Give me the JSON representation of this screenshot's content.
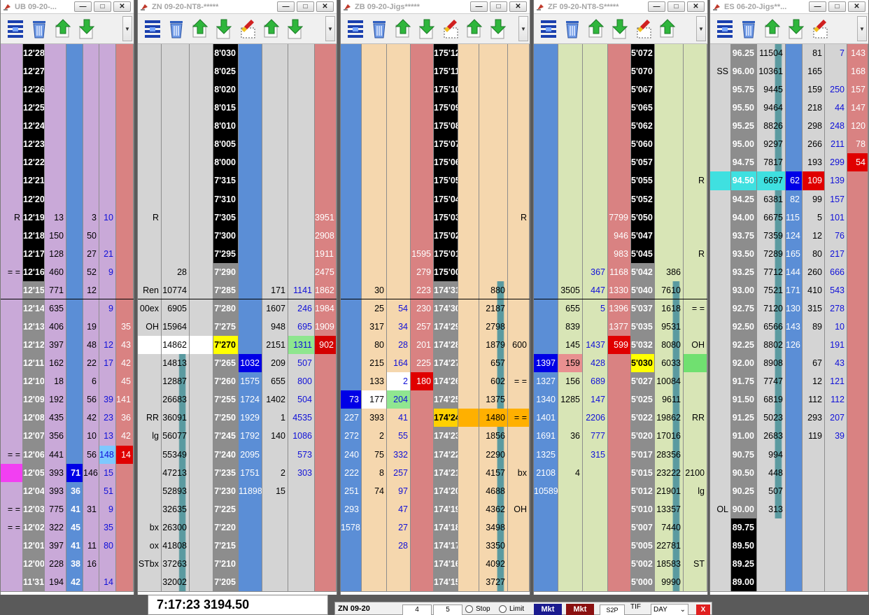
{
  "windows": [
    {
      "title": "UB 09-20-...",
      "prices": [
        "12'28",
        "12'27",
        "12'26",
        "12'25",
        "12'24",
        "12'23",
        "12'22",
        "12'21",
        "12'20",
        "12'19",
        "12'18",
        "12'17",
        "12'16",
        "12'15",
        "12'14",
        "12'13",
        "12'12",
        "12'11",
        "12'10",
        "12'09",
        "12'08",
        "12'07",
        "12'06",
        "12'05",
        "12'04",
        "12'03",
        "12'02",
        "12'01",
        "12'00",
        "11'31"
      ],
      "notes": {
        "9": "R",
        "12": "= =",
        "22": "= =",
        "25": "= =",
        "26": "= ="
      },
      "volume": {
        "9": "13",
        "10": "150",
        "11": "128",
        "12": "460",
        "13": "771",
        "14": "635",
        "15": "406",
        "16": "397",
        "17": "162",
        "18": "18",
        "19": "192",
        "20": "435",
        "21": "356",
        "22": "441",
        "23": "393",
        "24": "393",
        "25": "775",
        "26": "322",
        "27": "397",
        "28": "228",
        "29": "194"
      },
      "bid": {
        "23": "71",
        "24": "36",
        "25": "41",
        "26": "45",
        "27": "41",
        "28": "38",
        "29": "42"
      },
      "ask": {
        "9": "3",
        "10": "50",
        "11": "27",
        "12": "52",
        "13": "12",
        "15": "19",
        "16": "48",
        "17": "22",
        "18": "6",
        "19": "56",
        "20": "42",
        "21": "10",
        "22": "56",
        "23": "146",
        "25": "31",
        "27": "11",
        "28": "16"
      },
      "askb": {
        "9": "10",
        "11": "21",
        "12": "9",
        "14": "9",
        "16": "12",
        "17": "17",
        "19": "39",
        "20": "23",
        "21": "13",
        "22": "148",
        "23": "15",
        "24": "51",
        "25": "9",
        "26": "35",
        "27": "80",
        "29": "14"
      },
      "red": {
        "15": "35",
        "16": "43",
        "17": "42",
        "18": "45",
        "19": "141",
        "20": "36",
        "21": "42",
        "22": "14"
      }
    },
    {
      "title": "ZN 09-20-NT8-*****",
      "prices": [
        "8'030",
        "8'025",
        "8'020",
        "8'015",
        "8'010",
        "8'005",
        "8'000",
        "7'315",
        "7'310",
        "7'305",
        "7'300",
        "7'295",
        "7'290",
        "7'285",
        "7'280",
        "7'275",
        "7'270",
        "7'265",
        "7'260",
        "7'255",
        "7'250",
        "7'245",
        "7'240",
        "7'235",
        "7'230",
        "7'225",
        "7'220",
        "7'215",
        "7'210",
        "7'205"
      ],
      "notes": {
        "9": "R",
        "13": "Ren",
        "14": "00ex",
        "15": "OH",
        "20": "RR",
        "21": "lg",
        "26": "bx",
        "27": "ox",
        "28": "STbx"
      },
      "volume": {
        "12": "28",
        "13": "10774",
        "14": "6905",
        "15": "15964",
        "16": "14862",
        "17": "14813",
        "18": "12887",
        "19": "26683",
        "20": "36091",
        "21": "56077",
        "22": "55349",
        "23": "47213",
        "24": "52893",
        "25": "32635",
        "26": "26300",
        "27": "41808",
        "28": "37263",
        "29": "32002"
      },
      "bid": {
        "17": "1032",
        "18": "1575",
        "19": "1724",
        "20": "1929",
        "21": "1792",
        "22": "2095",
        "23": "1751",
        "24": "11898"
      },
      "ask": {
        "13": "171",
        "14": "1607",
        "15": "948",
        "16": "2151",
        "17": "209",
        "18": "655",
        "19": "1402",
        "20": "1",
        "21": "140",
        "23": "2",
        "24": "15"
      },
      "askb": {
        "13": "1141",
        "14": "246",
        "15": "695",
        "16": "1311",
        "17": "507",
        "18": "800",
        "19": "504",
        "20": "4535",
        "21": "1086",
        "22": "573",
        "23": "303"
      },
      "red": {
        "9": "3951",
        "10": "2908",
        "11": "1911",
        "12": "2475",
        "13": "1862",
        "14": "1984",
        "15": "1909",
        "16": "902"
      }
    },
    {
      "title": "ZB 09-20-Jigs*****",
      "prices": [
        "175'12",
        "175'11",
        "175'10",
        "175'09",
        "175'08",
        "175'07",
        "175'06",
        "175'05",
        "175'04",
        "175'03",
        "175'02",
        "175'01",
        "175'00",
        "174'31",
        "174'30",
        "174'29",
        "174'28",
        "174'27",
        "174'26",
        "174'25",
        "174'24",
        "174'23",
        "174'22",
        "174'21",
        "174'20",
        "174'19",
        "174'18",
        "174'17",
        "174'16",
        "174'15"
      ],
      "notes": {
        "9": "R",
        "16": "600",
        "18": "= =",
        "20": "= =",
        "23": "bx",
        "25": "OH"
      },
      "bid": {
        "19": "73",
        "20": "227",
        "21": "272",
        "22": "240",
        "23": "222",
        "24": "251",
        "25": "293",
        "26": "1578"
      },
      "b2": {
        "13": "30",
        "14": "25",
        "15": "317",
        "16": "80",
        "17": "215",
        "18": "133",
        "19": "177",
        "20": "393",
        "21": "2",
        "22": "75",
        "23": "8",
        "24": "74"
      },
      "b3": {
        "14": "54",
        "15": "34",
        "16": "28",
        "17": "164",
        "18": "2",
        "19": "204",
        "20": "41",
        "21": "55",
        "22": "332",
        "23": "257",
        "24": "97",
        "25": "47",
        "26": "27",
        "27": "28"
      },
      "red": {
        "11": "1595",
        "12": "279",
        "13": "223",
        "14": "230",
        "15": "257",
        "16": "201",
        "17": "225",
        "18": "180"
      },
      "volume": {
        "13": "880",
        "14": "2187",
        "15": "2798",
        "16": "1879",
        "17": "657",
        "18": "602",
        "19": "1375",
        "20": "1480",
        "21": "1856",
        "22": "2290",
        "23": "4157",
        "24": "4688",
        "25": "4362",
        "26": "3498",
        "27": "3350",
        "28": "4092",
        "29": "3727"
      }
    },
    {
      "title": "ZF 09-20-NT8-S*****",
      "prices": [
        "5'072",
        "5'070",
        "5'067",
        "5'065",
        "5'062",
        "5'060",
        "5'057",
        "5'055",
        "5'052",
        "5'050",
        "5'047",
        "5'045",
        "5'042",
        "5'040",
        "5'037",
        "5'035",
        "5'032",
        "5'030",
        "5'027",
        "5'025",
        "5'022",
        "5'020",
        "5'017",
        "5'015",
        "5'012",
        "5'010",
        "5'007",
        "5'005",
        "5'002",
        "5'000"
      ],
      "notes": {
        "7": "R",
        "11": "R",
        "14": "= =",
        "16": "OH",
        "20": "RR",
        "23": "2100",
        "24": "lg",
        "28": "ST"
      },
      "bid": {
        "17": "1397",
        "18": "1327",
        "19": "1340",
        "20": "1401",
        "21": "1691",
        "22": "1325",
        "23": "2108",
        "24": "10589"
      },
      "b2": {
        "13": "3505",
        "14": "655",
        "15": "839",
        "16": "145",
        "17": "159",
        "18": "156",
        "19": "1285",
        "21": "36",
        "23": "4"
      },
      "b3": {
        "12": "367",
        "13": "447",
        "14": "5",
        "16": "1437",
        "17": "428",
        "18": "689",
        "19": "147",
        "20": "2206",
        "21": "777",
        "22": "315"
      },
      "red": {
        "9": "7799",
        "10": "946",
        "11": "983",
        "12": "1168",
        "13": "1330",
        "14": "1396",
        "15": "1377",
        "16": "599"
      },
      "volume": {
        "12": "386",
        "13": "7610",
        "14": "1618",
        "15": "9531",
        "16": "8080",
        "17": "6033",
        "18": "10084",
        "19": "9611",
        "20": "19862",
        "21": "17016",
        "22": "28356",
        "23": "23222",
        "24": "21901",
        "25": "13357",
        "26": "7440",
        "27": "22781",
        "28": "18583",
        "29": "9990"
      }
    },
    {
      "title": "ES 06-20-Jigs**...",
      "prices": [
        "96.25",
        "96.00",
        "95.75",
        "95.50",
        "95.25",
        "95.00",
        "94.75",
        "94.50",
        "94.25",
        "94.00",
        "93.75",
        "93.50",
        "93.25",
        "93.00",
        "92.75",
        "92.50",
        "92.25",
        "92.00",
        "91.75",
        "91.50",
        "91.25",
        "91.00",
        "90.75",
        "90.50",
        "90.25",
        "90.00",
        "89.75",
        "89.50",
        "89.25",
        "89.00"
      ],
      "notes": {
        "1": "SS",
        "25": "OL"
      },
      "volume": {
        "0": "11504",
        "1": "10361",
        "2": "9445",
        "3": "9464",
        "4": "8826",
        "5": "9297",
        "6": "7817",
        "7": "6697",
        "8": "6381",
        "9": "6675",
        "10": "7359",
        "11": "7289",
        "12": "7712",
        "13": "7521",
        "14": "7120",
        "15": "6566",
        "16": "8802",
        "17": "8908",
        "18": "7747",
        "19": "6819",
        "20": "5023",
        "21": "2683",
        "22": "994",
        "23": "448",
        "24": "507",
        "25": "313"
      },
      "bid": {
        "7": "62",
        "8": "82",
        "9": "115",
        "10": "124",
        "11": "165",
        "12": "144",
        "13": "171",
        "14": "130",
        "15": "143",
        "16": "126"
      },
      "ask": {
        "0": "81",
        "1": "165",
        "2": "159",
        "3": "218",
        "4": "298",
        "5": "266",
        "6": "193",
        "7": "109",
        "8": "99",
        "9": "5",
        "10": "12",
        "11": "80",
        "12": "260",
        "13": "410",
        "14": "315",
        "15": "89",
        "17": "67",
        "18": "12",
        "19": "112",
        "20": "293",
        "21": "119"
      },
      "askb": {
        "0": "7",
        "2": "250",
        "3": "44",
        "4": "248",
        "5": "211",
        "6": "299",
        "7": "139",
        "8": "157",
        "9": "101",
        "10": "76",
        "11": "217",
        "12": "666",
        "13": "543",
        "14": "278",
        "15": "10",
        "16": "191",
        "17": "43",
        "18": "121",
        "19": "112",
        "20": "207",
        "21": "39"
      },
      "red": {
        "0": "143",
        "1": "168",
        "2": "157",
        "3": "147",
        "4": "120",
        "5": "78",
        "6": "54"
      }
    }
  ],
  "clock": "7:17:23 3194.50",
  "order_bar": {
    "symbol": "ZN 09-20",
    "qty1": "4",
    "qty2": "5",
    "stop": "Stop",
    "limit": "Limit",
    "mkt1": "Mkt",
    "mkt2": "Mkt",
    "s2p": "S2P",
    "tif": "TIF",
    "tif_value": "DAY",
    "close": "X"
  },
  "colors": {
    "ub_bg": "#c9a9d8",
    "zn_bg": "#d4d4d4",
    "zb_bg": "#f5d7ae",
    "zf_bg": "#d8e5b6",
    "es_bg": "#d4d4d4",
    "bid_blue": "#5b8ed6",
    "ask_red": "#d98282",
    "teal": "#5a9aa0"
  }
}
